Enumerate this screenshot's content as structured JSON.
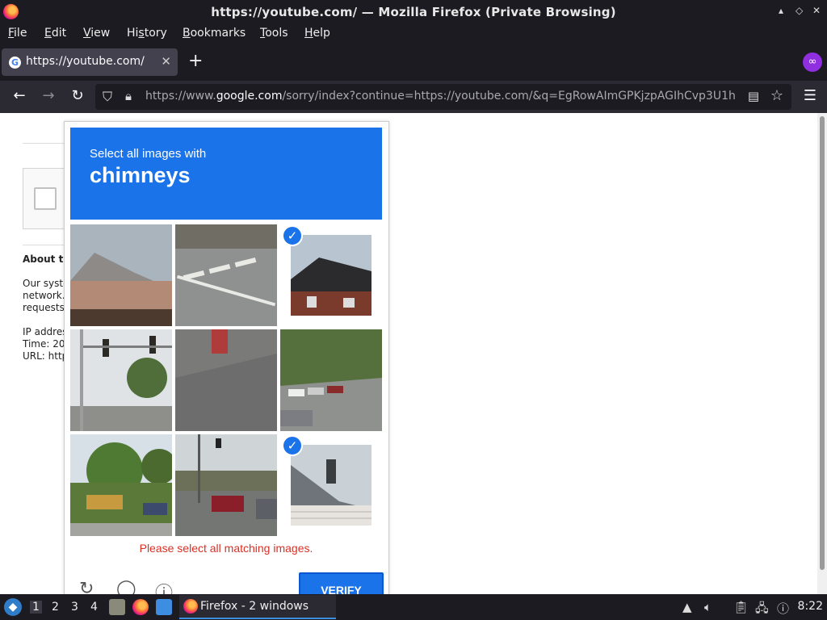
{
  "window": {
    "title": "https://youtube.com/ — Mozilla Firefox (Private Browsing)",
    "controls": [
      "▴",
      "◇",
      "✕"
    ]
  },
  "menu": [
    {
      "pre": "",
      "u": "F",
      "post": "ile"
    },
    {
      "pre": "",
      "u": "E",
      "post": "dit"
    },
    {
      "pre": "",
      "u": "V",
      "post": "iew"
    },
    {
      "pre": "Hi",
      "u": "s",
      "post": "tory"
    },
    {
      "pre": "",
      "u": "B",
      "post": "ookmarks"
    },
    {
      "pre": "",
      "u": "T",
      "post": "ools"
    },
    {
      "pre": "",
      "u": "H",
      "post": "elp"
    }
  ],
  "tab": {
    "label": "https://youtube.com/",
    "close": "✕"
  },
  "newtab": "+",
  "urlbar": {
    "prefix": "https://www.",
    "host": "google.com",
    "rest": "/sorry/index?continue=https://youtube.com/&q=EgRowAImGPKjzpAGIhCvp3U1h"
  },
  "page": {
    "about_title": "About th",
    "about_lines": [
      "Our syste",
      "network.",
      "requests"
    ],
    "meta_lines": [
      "IP addres",
      "Time: 20",
      "URL: http"
    ]
  },
  "captcha": {
    "prompt": "Select all images with",
    "target": "chimneys",
    "error": "Please select all matching images.",
    "verify": "VERIFY",
    "tiles": [
      {
        "kind": "house",
        "selected": false
      },
      {
        "kind": "crosswalk",
        "selected": false
      },
      {
        "kind": "house-dark",
        "selected": true
      },
      {
        "kind": "traffic-lights",
        "selected": false
      },
      {
        "kind": "pavement",
        "selected": false
      },
      {
        "kind": "road-cars",
        "selected": false
      },
      {
        "kind": "truck-yard",
        "selected": false
      },
      {
        "kind": "street-car",
        "selected": false
      },
      {
        "kind": "roof-chimney",
        "selected": true
      }
    ]
  },
  "taskbar": {
    "workspaces": [
      "1",
      "2",
      "3",
      "4"
    ],
    "task_label": "Firefox - 2 windows",
    "clock": "8:22"
  }
}
